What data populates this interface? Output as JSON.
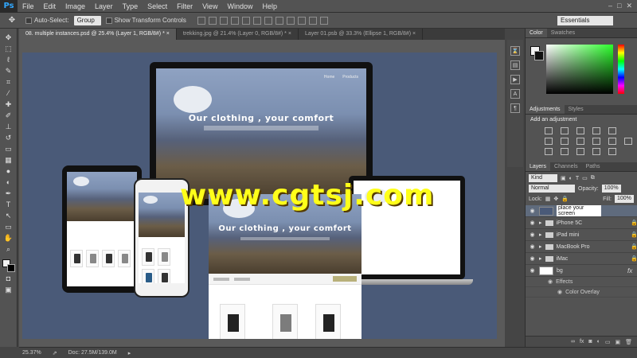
{
  "app": {
    "logo": "Ps"
  },
  "menu": [
    "File",
    "Edit",
    "Image",
    "Layer",
    "Type",
    "Select",
    "Filter",
    "View",
    "Window",
    "Help"
  ],
  "window_controls": [
    "–",
    "□",
    "✕"
  ],
  "options": {
    "auto_select_label": "Auto-Select:",
    "group_value": "Group",
    "transform_label": "Show Transform Controls",
    "workspace": "Essentials"
  },
  "tabs": [
    "08. multiple instances.psd @ 25.4% (Layer 1, RGB/8#) *  ×",
    "trekking.jpg @ 21.4% (Layer 0, RGB/8#) *  ×",
    "Layer 01.psb @ 33.3% (Ellipse 1, RGB/8#)  ×"
  ],
  "mockup": {
    "nav": [
      "Home",
      "Products"
    ],
    "hero": "Our clothing , your comfort"
  },
  "watermark": "www.cgtsj.com",
  "status": {
    "zoom": "25.37%",
    "doc": "Doc: 27.5M/139.0M"
  },
  "panels": {
    "color_tab": "Color",
    "swatches_tab": "Swatches",
    "adjustments_tab": "Adjustments",
    "styles_tab": "Styles",
    "add_adjustment": "Add an adjustment",
    "layers_tab": "Layers",
    "channels_tab": "Channels",
    "paths_tab": "Paths",
    "kind": "Kind",
    "blend": "Normal",
    "opacity_label": "Opacity:",
    "opacity": "100%",
    "lock_label": "Lock:",
    "fill_label": "Fill:",
    "fill": "100%"
  },
  "layers": [
    {
      "name": "place your screen",
      "editing": true
    },
    {
      "name": "iPhone 5C"
    },
    {
      "name": "iPad mini"
    },
    {
      "name": "MacBook Pro"
    },
    {
      "name": "iMac"
    },
    {
      "name": "bg",
      "fx": "fx"
    }
  ],
  "effects": {
    "label": "Effects",
    "item": "Color Overlay"
  },
  "colors": {
    "accent": "#31a8ff",
    "canvas_bg": "#4a5a78",
    "watermark": "#ffff1a"
  }
}
